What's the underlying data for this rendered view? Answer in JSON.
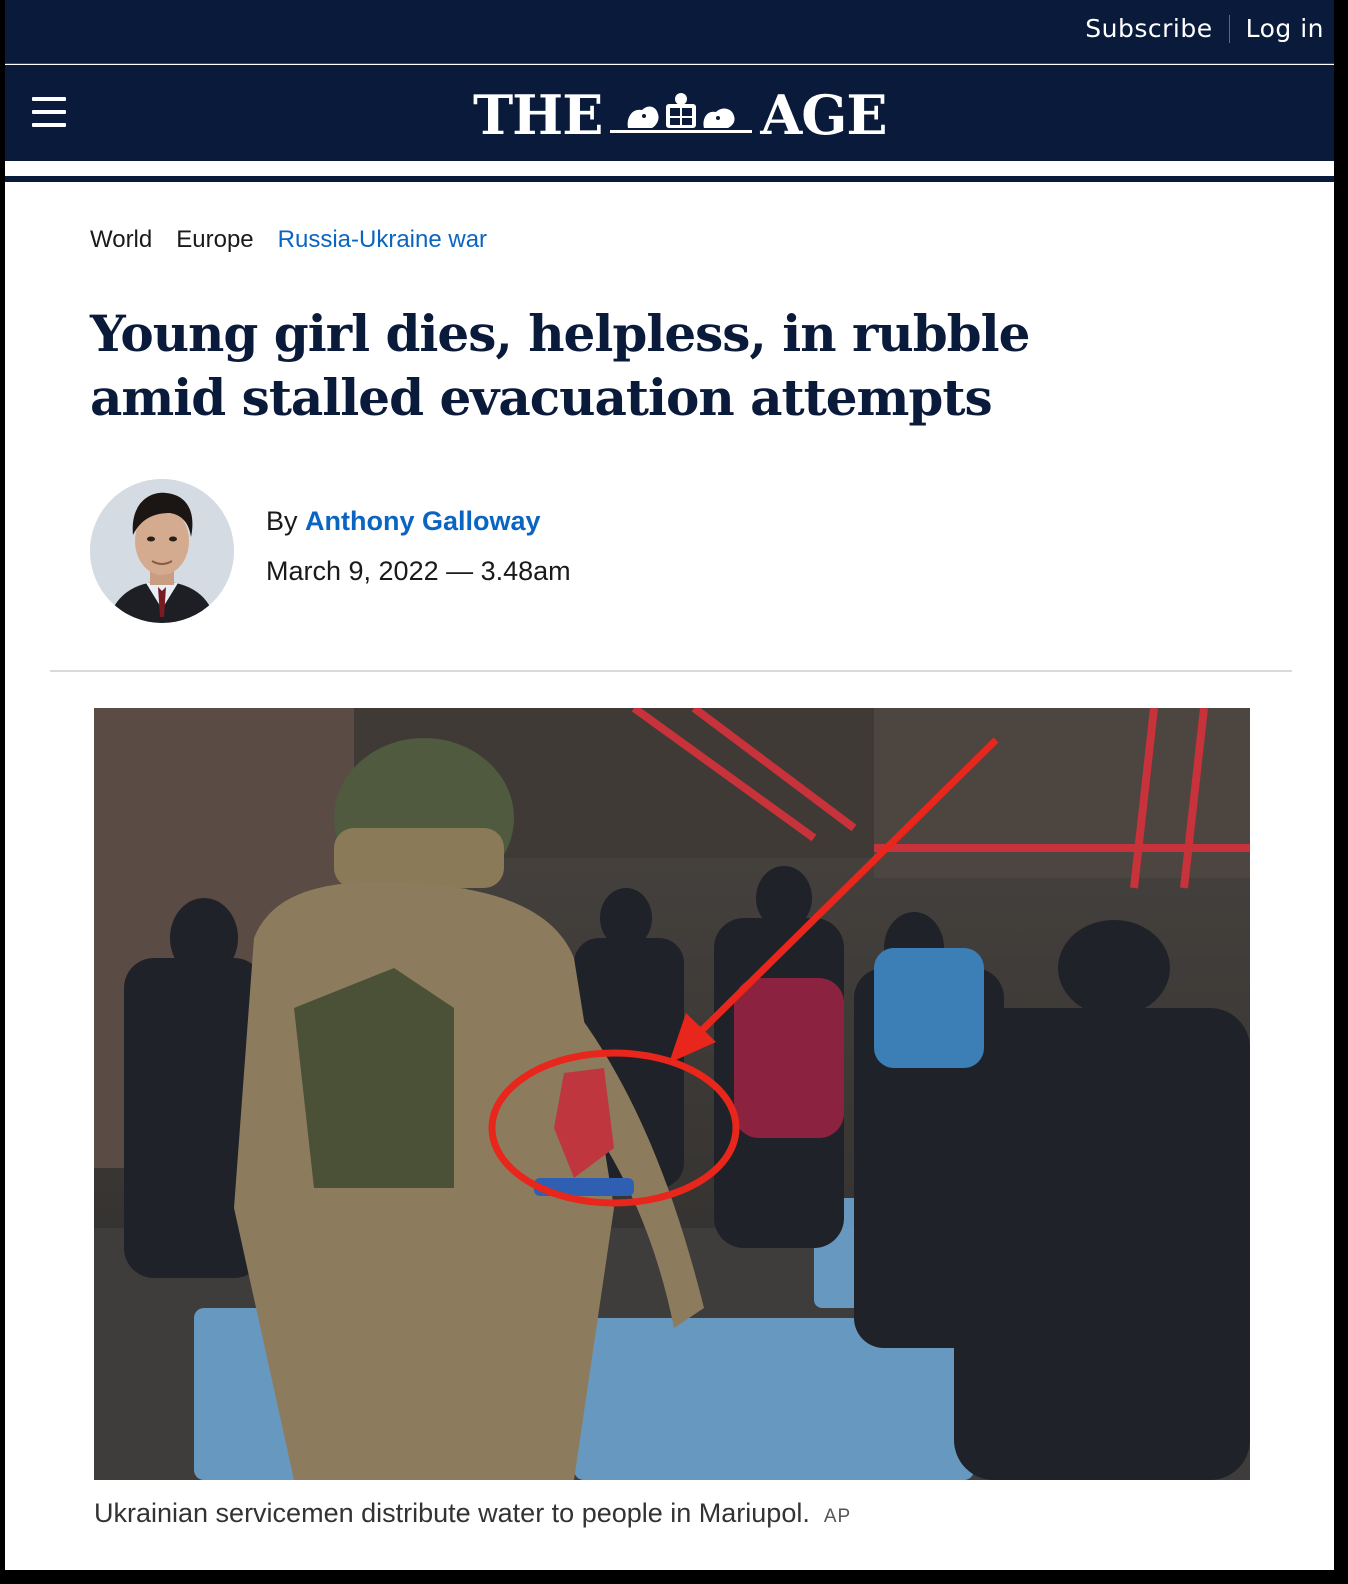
{
  "header": {
    "subscribe_label": "Subscribe",
    "login_label": "Log in",
    "logo_left": "THE",
    "logo_right": "AGE",
    "colors": {
      "navy": "#0a1a3a",
      "link_blue": "#0a65c2"
    }
  },
  "breadcrumb": {
    "items": [
      "World",
      "Europe",
      "Russia-Ukraine war"
    ]
  },
  "article": {
    "headline": "Young girl dies, helpless, in rubble amid stalled evacuation attempts",
    "byline_prefix": "By",
    "author": "Anthony Galloway",
    "date": "March 9, 2022 — 3.48am"
  },
  "photo": {
    "caption": "Ukrainian servicemen distribute water to people in Mariupol.",
    "credit": "AP",
    "annotation": {
      "arrow_color": "#e8261b",
      "ellipse_color": "#e8261b"
    }
  }
}
